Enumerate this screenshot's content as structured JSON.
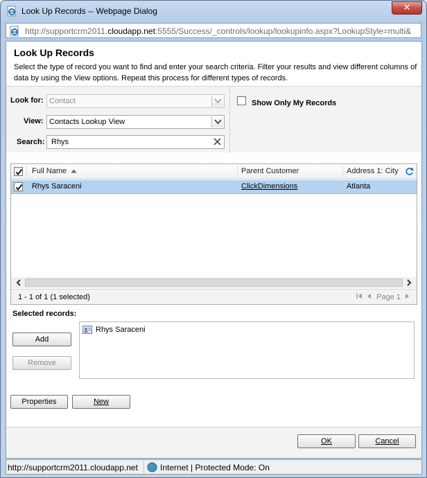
{
  "window": {
    "title": "Look Up Records -- Webpage Dialog",
    "close_glyph": "✕"
  },
  "address": {
    "url_prefix": "http://supportcrm2011.",
    "url_domain": "cloudapp.net",
    "url_suffix": ":5555/Success/_controls/lookup/lookupinfo.aspx?LookupStyle=multi&"
  },
  "header": {
    "title": "Look Up Records",
    "description": "Select the type of record you want to find and enter your search criteria. Filter your results and view different columns of data by using the View options. Repeat this process for different types of records."
  },
  "criteria": {
    "look_for_label": "Look for:",
    "look_for_value": "Contact",
    "view_label": "View:",
    "view_value": "Contacts Lookup View",
    "search_label": "Search:",
    "search_value": "Rhys",
    "show_only_my_records_label": "Show Only My Records",
    "show_only_my_records_checked": false
  },
  "grid": {
    "columns": [
      "Full Name",
      "Parent Customer",
      "Address 1: City"
    ],
    "sort_column": "Full Name",
    "sort_direction": "ascending",
    "rows": [
      {
        "checked": true,
        "full_name": "Rhys Saraceni",
        "parent_customer": "ClickDimensions",
        "city": "Atlanta"
      }
    ],
    "record_count": "1 - 1 of 1 (1 selected)",
    "page_label": "Page 1"
  },
  "selected": {
    "label": "Selected records:",
    "items": [
      "Rhys Saraceni"
    ],
    "add_label": "Add",
    "remove_label": "Remove"
  },
  "actions": {
    "properties_label": "Properties",
    "new_label": "New",
    "ok_label": "OK",
    "cancel_label": "Cancel"
  },
  "statusbar": {
    "url": "http://supportcrm2011.cloudapp.net",
    "zone": "Internet | Protected Mode: On"
  },
  "colors": {
    "selected_row": "#b5d2f0",
    "panel_bg": "#f3f3f3",
    "frame": "#c7daf0"
  }
}
